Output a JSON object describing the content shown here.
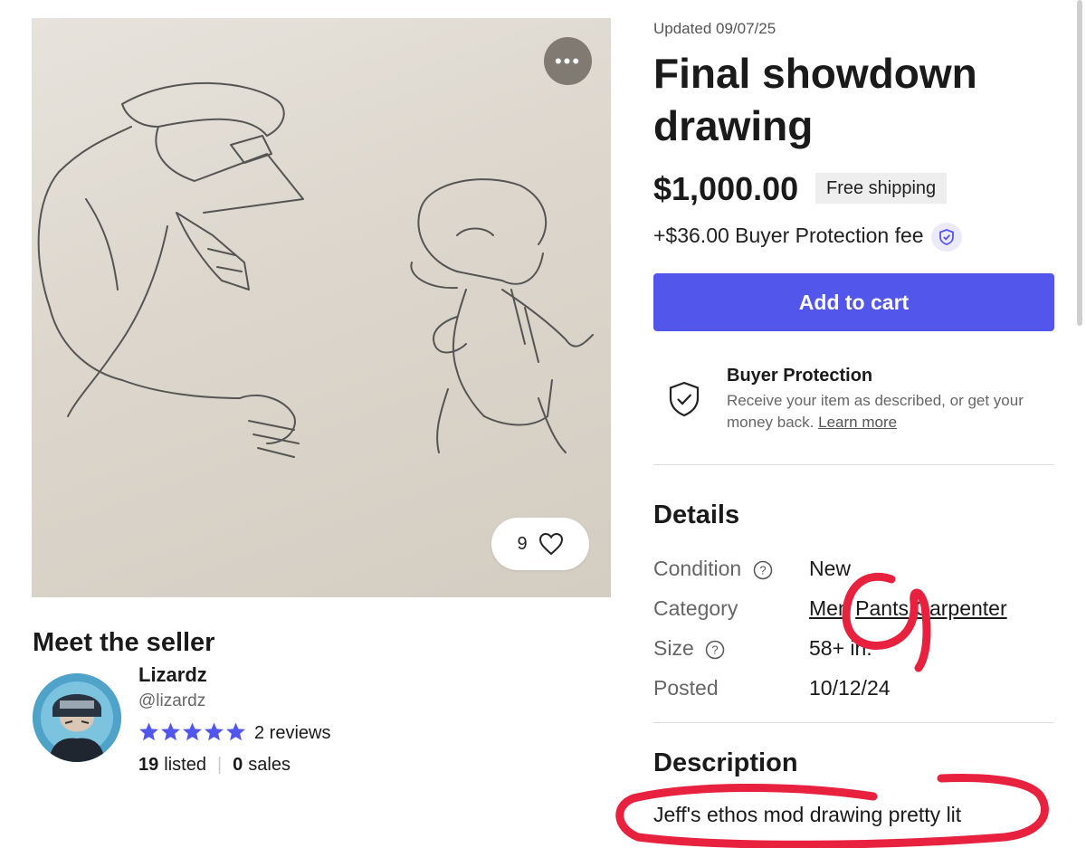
{
  "listing": {
    "updated": "Updated 09/07/25",
    "title": "Final showdown drawing",
    "price": "$1,000.00",
    "shipping_badge": "Free shipping",
    "fee": "+$36.00 Buyer Protection fee",
    "add_to_cart": "Add to cart",
    "likes": "9",
    "more_icon": "more-options-icon",
    "like_icon": "heart-icon"
  },
  "buyer_protection": {
    "title": "Buyer Protection",
    "description": "Receive your item as described, or get your money back.",
    "learn_more": "Learn more",
    "icon": "shield-check-icon"
  },
  "details": {
    "heading": "Details",
    "rows": [
      {
        "label": "Condition",
        "value": "New"
      },
      {
        "label": "Category",
        "value_parts": [
          "Men",
          "Pants",
          "Carpenter"
        ]
      },
      {
        "label": "Size",
        "value": "58+ in."
      },
      {
        "label": "Posted",
        "value": "10/12/24"
      }
    ]
  },
  "description": {
    "heading": "Description",
    "text": "Jeff's ethos mod drawing pretty lit"
  },
  "seller": {
    "heading": "Meet the seller",
    "name": "Lizardz",
    "handle": "@lizardz",
    "rating_stars": 5,
    "reviews": "2 reviews",
    "listed_count": "19",
    "listed_label": "listed",
    "sales_count": "0",
    "sales_label": "sales"
  },
  "colors": {
    "accent": "#5256eb",
    "annotation": "#e8213f"
  }
}
